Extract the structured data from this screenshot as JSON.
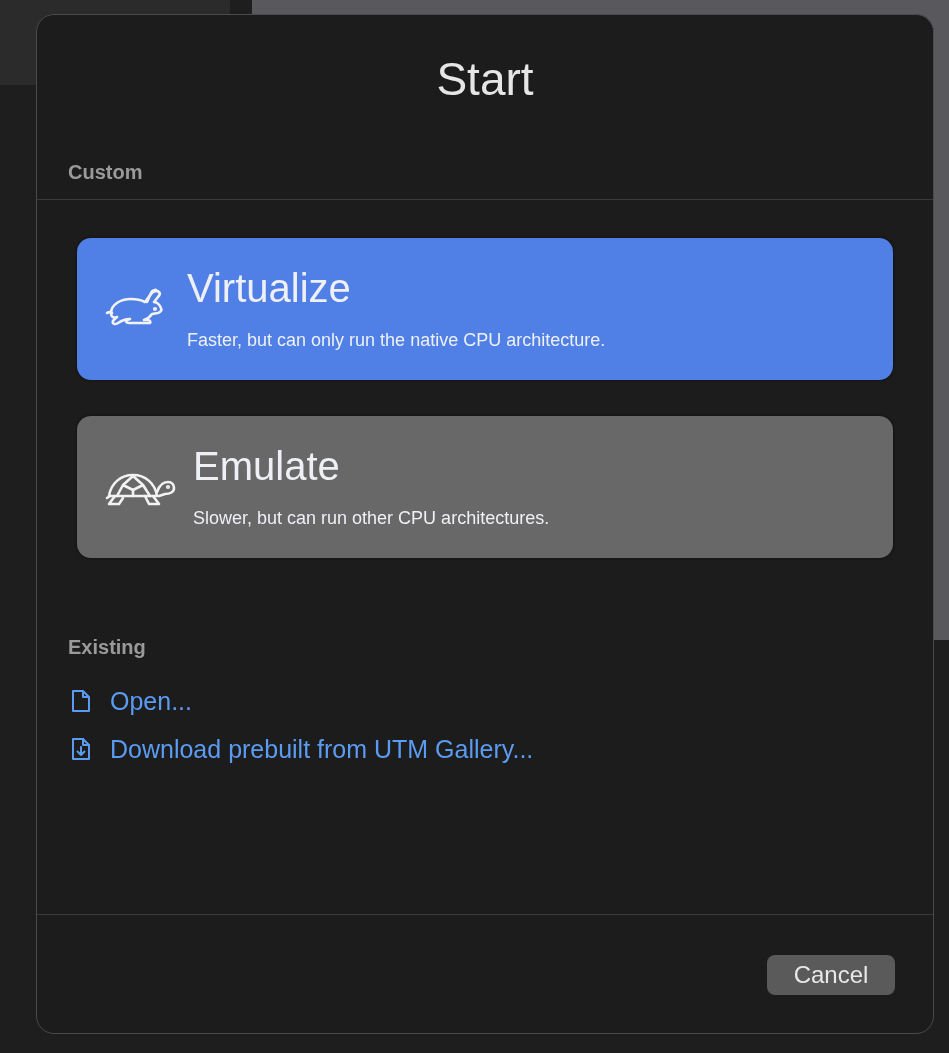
{
  "dialog": {
    "title": "Start",
    "custom": {
      "heading": "Custom",
      "options": [
        {
          "kind": "rabbit",
          "title": "Virtualize",
          "description": "Faster, but can only run the native CPU architecture.",
          "selected": true
        },
        {
          "kind": "turtle",
          "title": "Emulate",
          "description": "Slower, but can run other CPU architectures.",
          "selected": false
        }
      ]
    },
    "existing": {
      "heading": "Existing",
      "links": [
        {
          "kind": "file",
          "label": "Open..."
        },
        {
          "kind": "download",
          "label": "Download prebuilt from UTM Gallery..."
        }
      ]
    },
    "buttons": [
      "Cancel"
    ]
  }
}
